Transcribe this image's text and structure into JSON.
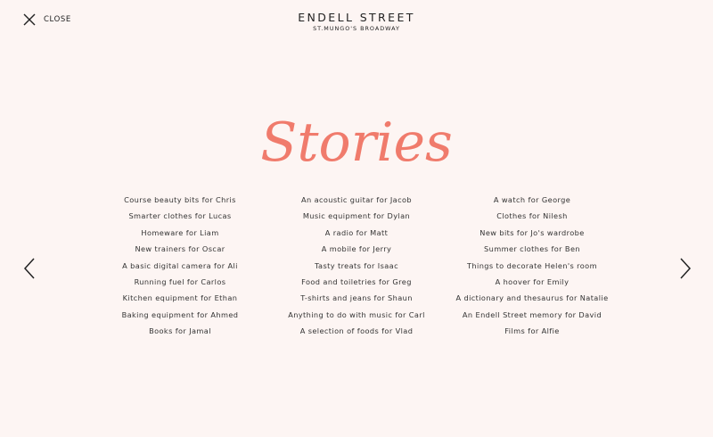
{
  "header": {
    "close_label": "CLOSE",
    "brand": "ENDELL STREET",
    "subtitle": "ST.MUNGO'S BROADWAY"
  },
  "title": "Stories",
  "accent_color": "#f07b6c",
  "columns": [
    [
      "Course beauty bits for Chris",
      "Smarter clothes for Lucas",
      "Homeware for Liam",
      "New trainers for Oscar",
      "A basic digital camera for Ali",
      "Running fuel for Carlos",
      "Kitchen equipment for Ethan",
      "Baking equipment for Ahmed",
      "Books for Jamal"
    ],
    [
      "An acoustic guitar for Jacob",
      "Music equipment for Dylan",
      "A radio for Matt",
      "A mobile for Jerry",
      "Tasty treats for Isaac",
      "Food and toiletries for Greg",
      "T-shirts and jeans for Shaun",
      "Anything to do with music for Carl",
      "A selection of foods for Vlad"
    ],
    [
      "A watch for George",
      "Clothes for Nilesh",
      "New bits for Jo's wardrobe",
      "Summer clothes for Ben",
      "Things to decorate Helen's room",
      "A hoover for Emily",
      "A dictionary and thesaurus for Natalie",
      "An Endell Street memory for David",
      "Films for Alfie"
    ]
  ],
  "nav": {
    "prev_icon": "chevron-left-icon",
    "next_icon": "chevron-right-icon"
  }
}
